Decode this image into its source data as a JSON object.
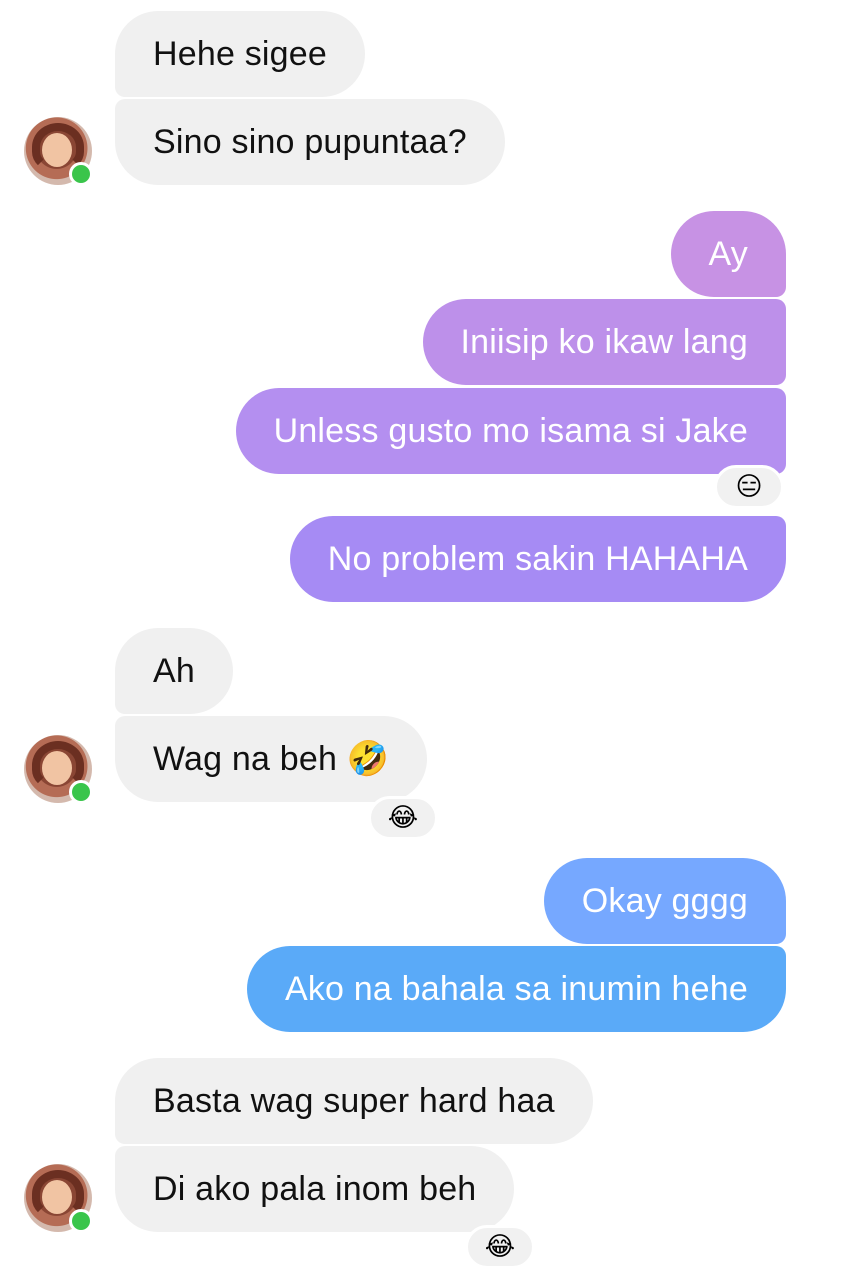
{
  "colors": {
    "incoming": "#f0f0f0",
    "out_purple_top": "#c792e4",
    "out_purple_mid": "#b58ff0",
    "out_purple_low": "#a78bf4",
    "out_blue_top": "#74a6ff",
    "out_blue_low": "#5aa9f8",
    "online": "#3ac54b"
  },
  "messages": [
    {
      "side": "in",
      "text": "Hehe sigee"
    },
    {
      "side": "in",
      "text": "Sino sino pupuntaa?"
    },
    {
      "side": "out",
      "text": "Ay"
    },
    {
      "side": "out",
      "text": "Iniisip ko ikaw lang"
    },
    {
      "side": "out",
      "text": "Unless gusto mo isama si Jake",
      "reaction": "😑"
    },
    {
      "side": "out",
      "text": "No problem sakin HAHAHA"
    },
    {
      "side": "in",
      "text": "Ah"
    },
    {
      "side": "in",
      "text": "Wag na beh 🤣",
      "reaction": "😂"
    },
    {
      "side": "out",
      "text": "Okay gggg"
    },
    {
      "side": "out",
      "text": "Ako na bahala sa inumin hehe"
    },
    {
      "side": "in",
      "text": "Basta wag super hard haa"
    },
    {
      "side": "in",
      "text": "Di ako pala inom beh",
      "reaction": "😂"
    }
  ],
  "avatar_icon": "contact-avatar-photo",
  "presence_icon": "online-dot-icon"
}
